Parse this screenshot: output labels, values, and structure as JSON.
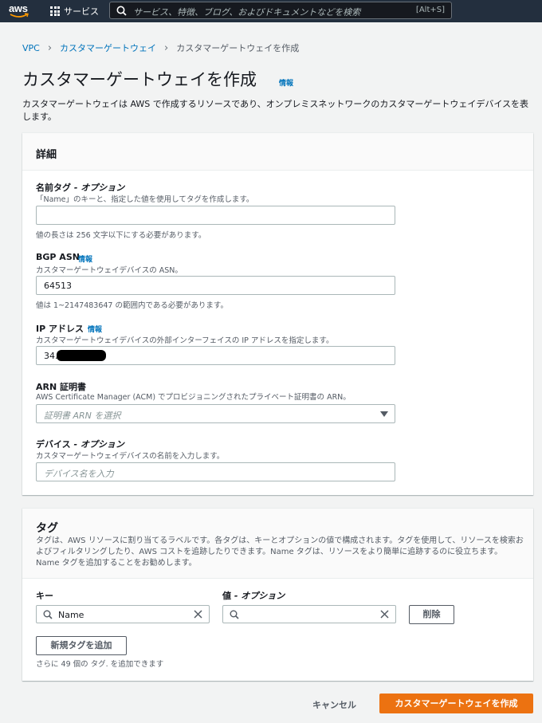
{
  "topbar": {
    "logo_text": "aws",
    "services_label": "サービス",
    "search_placeholder": "サービス、特徴、ブログ、およびドキュメントなどを検索",
    "search_shortcut": "[Alt+S]"
  },
  "breadcrumb": {
    "items": [
      "VPC",
      "カスタマーゲートウェイ"
    ],
    "current": "カスタマーゲートウェイを作成"
  },
  "page": {
    "title": "カスタマーゲートウェイを作成",
    "info_link": "情報",
    "description": "カスタマーゲートウェイは AWS で作成するリソースであり、オンプレミスネットワークのカスタマーゲートウェイデバイスを表します。"
  },
  "details": {
    "heading": "詳細",
    "name_tag": {
      "label": "名前タグ",
      "label_suffix": " - オプション",
      "description": "「Name」のキーと、指定した値を使用してタグを作成します。",
      "value": "",
      "hint": "値の長さは 256 文字以下にする必要があります。"
    },
    "bgp_asn": {
      "label": "BGP ASN",
      "info": "情報",
      "description": "カスタマーゲートウェイデバイスの ASN。",
      "value": "64513",
      "hint": "値は 1~2147483647 の範囲内である必要があります。"
    },
    "ip_address": {
      "label": "IP アドレス",
      "info": "情報",
      "description": "カスタマーゲートウェイデバイスの外部インターフェイスの IP アドレスを指定します。",
      "value": "34."
    },
    "arn_cert": {
      "label": "ARN 証明書",
      "description": "AWS Certificate Manager (ACM) でプロビジョニングされたプライベート証明書の ARN。",
      "placeholder": "証明書 ARN を選択"
    },
    "device": {
      "label": "デバイス",
      "label_suffix": " - オプション",
      "description": "カスタマーゲートウェイデバイスの名前を入力します。",
      "placeholder": "デバイス名を入力"
    }
  },
  "tags": {
    "heading": "タグ",
    "description": "タグは、AWS リソースに割り当てるラベルです。各タグは、キーとオプションの値で構成されます。タグを使用して、リソースを検索およびフィルタリングしたり、AWS コストを追跡したりできます。Name タグは、リソースをより簡単に追跡するのに役立ちます。Name タグを追加することをお勧めします。",
    "key_label": "キー",
    "value_label": "値",
    "value_label_suffix": " - オプション",
    "key_value": "Name",
    "value_value": "",
    "remove_button": "削除",
    "add_button": "新規タグを追加",
    "remaining": "さらに 49 個の タグ. を追加できます"
  },
  "footer": {
    "cancel": "キャンセル",
    "submit": "カスタマーゲートウェイを作成"
  }
}
